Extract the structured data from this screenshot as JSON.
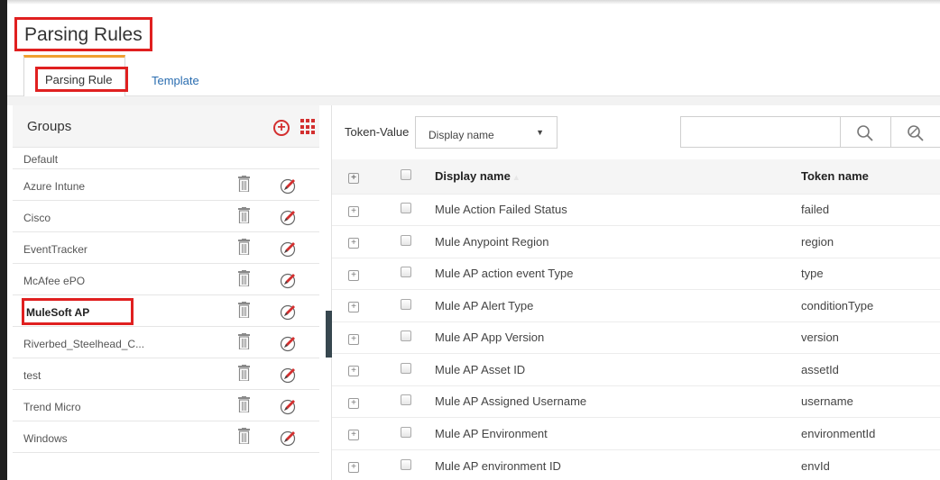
{
  "header": {
    "title": "Parsing Rules",
    "tabs": [
      {
        "label": "Parsing Rule",
        "active": true
      },
      {
        "label": "Template",
        "active": false
      }
    ]
  },
  "groups": {
    "title": "Groups",
    "items": [
      {
        "label": "Default",
        "actions": false,
        "selected": false
      },
      {
        "label": "Azure Intune",
        "actions": true,
        "selected": false
      },
      {
        "label": "Cisco",
        "actions": true,
        "selected": false
      },
      {
        "label": "EventTracker",
        "actions": true,
        "selected": false
      },
      {
        "label": "McAfee ePO",
        "actions": true,
        "selected": false
      },
      {
        "label": "MuleSoft AP",
        "actions": true,
        "selected": true
      },
      {
        "label": "Riverbed_Steelhead_C...",
        "actions": true,
        "selected": false
      },
      {
        "label": "test",
        "actions": true,
        "selected": false
      },
      {
        "label": "Trend Micro",
        "actions": true,
        "selected": false
      },
      {
        "label": "Windows",
        "actions": true,
        "selected": false
      }
    ]
  },
  "toolbar": {
    "token_value_label": "Token-Value",
    "select_value": "Display name"
  },
  "table": {
    "headers": {
      "display_name": "Display name",
      "token_name": "Token name"
    },
    "rows": [
      {
        "display_name": "Mule Action Failed Status",
        "token_name": "failed"
      },
      {
        "display_name": "Mule Anypoint Region",
        "token_name": "region"
      },
      {
        "display_name": "Mule AP action event Type",
        "token_name": "type"
      },
      {
        "display_name": "Mule AP Alert Type",
        "token_name": "conditionType"
      },
      {
        "display_name": "Mule AP App Version",
        "token_name": "version"
      },
      {
        "display_name": "Mule AP Asset ID",
        "token_name": "assetId"
      },
      {
        "display_name": "Mule AP Assigned Username",
        "token_name": "username"
      },
      {
        "display_name": "Mule AP Environment",
        "token_name": "environmentId"
      },
      {
        "display_name": "Mule AP environment ID",
        "token_name": "envId"
      }
    ]
  },
  "colors": {
    "accent": "#d32f2f",
    "tab_active_border": "#f0a030",
    "highlight_box": "#e02020",
    "link": "#2a6db0"
  }
}
